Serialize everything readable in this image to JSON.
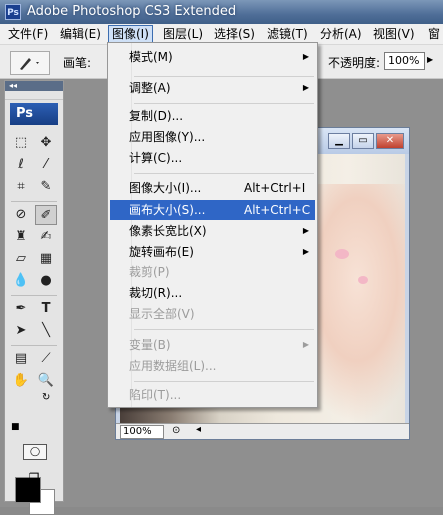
{
  "window": {
    "title": "Adobe Photoshop CS3 Extended",
    "logo": "Ps"
  },
  "menubar": [
    "文件(F)",
    "编辑(E)",
    "图像(I)",
    "图层(L)",
    "选择(S)",
    "滤镜(T)",
    "分析(A)",
    "视图(V)",
    "窗"
  ],
  "options": {
    "brush_label": "画笔:",
    "opacity_label": "不透明度:",
    "opacity_value": "100%"
  },
  "toolbox": {
    "header": "◂◂",
    "badge": "Ps"
  },
  "document": {
    "zoom": "100%"
  },
  "image_menu": {
    "items": [
      {
        "label": "模式(M)",
        "submenu": true
      },
      {
        "label": "调整(A)",
        "submenu": true
      },
      {
        "label": "复制(D)..."
      },
      {
        "label": "应用图像(Y)..."
      },
      {
        "label": "计算(C)..."
      },
      {
        "label": "图像大小(I)...",
        "shortcut": "Alt+Ctrl+I"
      },
      {
        "label": "画布大小(S)...",
        "shortcut": "Alt+Ctrl+C",
        "highlighted": true
      },
      {
        "label": "像素长宽比(X)",
        "submenu": true
      },
      {
        "label": "旋转画布(E)",
        "submenu": true
      },
      {
        "label": "裁剪(P)",
        "disabled": true
      },
      {
        "label": "裁切(R)..."
      },
      {
        "label": "显示全部(V)",
        "disabled": true
      },
      {
        "label": "变量(B)",
        "submenu": true,
        "disabled": true
      },
      {
        "label": "应用数据组(L)...",
        "disabled": true
      },
      {
        "label": "陷印(T)...",
        "disabled": true
      }
    ]
  },
  "colors": {
    "highlight": "#2f66c6",
    "title_bar": "#4f6e98"
  }
}
